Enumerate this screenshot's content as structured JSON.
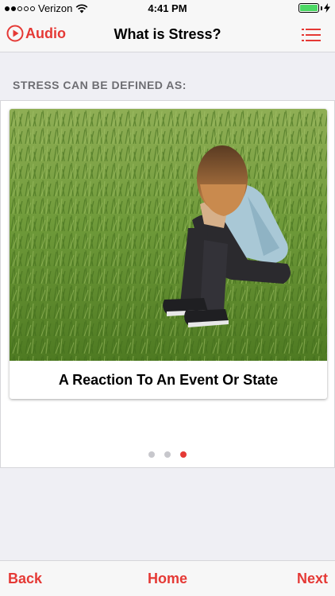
{
  "status_bar": {
    "carrier": "Verizon",
    "time": "4:41 PM",
    "signal_bars_filled": 2,
    "signal_bars_total": 5,
    "battery_level": 1.0,
    "icons": [
      "wifi-icon",
      "battery-icon",
      "charging-bolt-icon"
    ]
  },
  "nav": {
    "audio_label": "Audio",
    "title": "What is Stress?",
    "icons": [
      "play-circle-icon",
      "list-menu-icon"
    ]
  },
  "section": {
    "heading": "STRESS CAN BE DEFINED AS:"
  },
  "carousel": {
    "caption": "A Reaction To An Event Or State",
    "page_count": 3,
    "current_page": 3
  },
  "toolbar": {
    "back_label": "Back",
    "home_label": "Home",
    "next_label": "Next"
  },
  "colors": {
    "accent": "#e53935",
    "background": "#efeff4",
    "bar": "#f7f7f7",
    "battery": "#4cd964"
  }
}
